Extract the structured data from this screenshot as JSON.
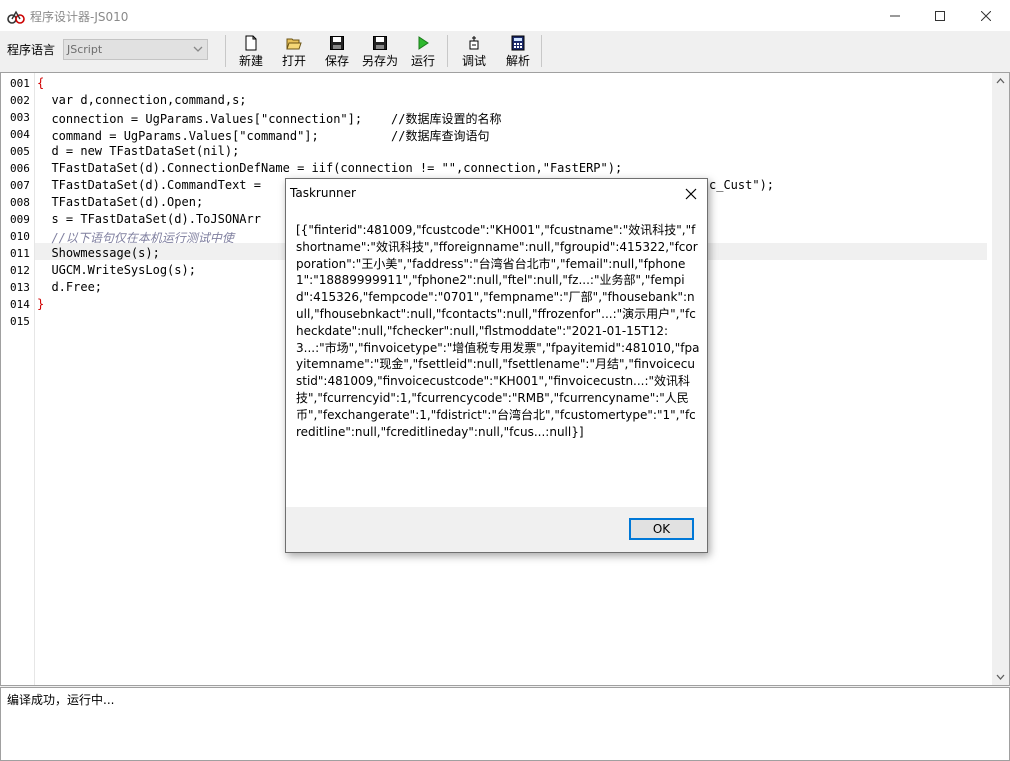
{
  "window": {
    "title": "程序设计器-JS010"
  },
  "toolbar": {
    "language_label": "程序语言",
    "language_value": "JScript",
    "buttons": [
      {
        "label": "新建",
        "icon": "new-file-icon"
      },
      {
        "label": "打开",
        "icon": "open-folder-icon"
      },
      {
        "label": "保存",
        "icon": "save-icon"
      },
      {
        "label": "另存为",
        "icon": "save-as-icon"
      },
      {
        "label": "运行",
        "icon": "run-icon"
      },
      {
        "label": "调试",
        "icon": "debug-icon"
      },
      {
        "label": "解析",
        "icon": "calculator-icon"
      }
    ]
  },
  "editor": {
    "line_numbers": [
      "001",
      "002",
      "003",
      "004",
      "005",
      "006",
      "007",
      "008",
      "009",
      "010",
      "011",
      "012",
      "013",
      "014",
      "015"
    ],
    "lines": [
      "{",
      "  var d,connection,command,s;",
      "  connection = UgParams.Values[\"connection\"];    //数据库设置的名称",
      "  command = UgParams.Values[\"command\"];          //数据库查询语句",
      "  d = new TFastDataSet(nil);",
      "  TFastDataSet(d).ConnectionDefName = iif(connection != \"\",connection,\"FastERP\");",
      "  TFastDataSet(d).CommandText =",
      "  TFastDataSet(d).Open;",
      "  s = TFastDataSet(d).ToJSONArr",
      "  //以下语句仅在本机运行测试中使",
      "  Showmessage(s);",
      "  UGCM.WriteSysLog(s);",
      "  d.Free;",
      "}",
      ""
    ],
    "line7_tail": "c_Cust\");"
  },
  "output": {
    "text": "编译成功，运行中..."
  },
  "dialog": {
    "title": "Taskrunner",
    "message": "[{\"finterid\":481009,\"fcustcode\":\"KH001\",\"fcustname\":\"效讯科技\",\"fshortname\":\"效讯科技\",\"fforeignname\":null,\"fgroupid\":415322,\"fcorporation\":\"王小美\",\"faddress\":\"台湾省台北市\",\"femail\":null,\"fphone1\":\"18889999911\",\"fphone2\":null,\"ftel\":null,\"fz...:\"业务部\",\"fempid\":415326,\"fempcode\":\"0701\",\"fempname\":\"厂部\",\"fhousebank\":null,\"fhousebnkact\":null,\"fcontacts\":null,\"ffrozenfor\"...:\"演示用户\",\"fcheckdate\":null,\"fchecker\":null,\"flstmoddate\":\"2021-01-15T12:3...:\"市场\",\"finvoicetype\":\"增值税专用发票\",\"fpayitemid\":481010,\"fpayitemname\":\"现金\",\"fsettleid\":null,\"fsettlename\":\"月结\",\"finvoicecustid\":481009,\"finvoicecustcode\":\"KH001\",\"finvoicecustn...:\"效讯科技\",\"fcurrencyid\":1,\"fcurrencycode\":\"RMB\",\"fcurrencyname\":\"人民币\",\"fexchangerate\":1,\"fdistrict\":\"台湾台北\",\"fcustomertype\":\"1\",\"fcreditline\":null,\"fcreditlineday\":null,\"fcus...:null}]",
    "ok_label": "OK"
  }
}
